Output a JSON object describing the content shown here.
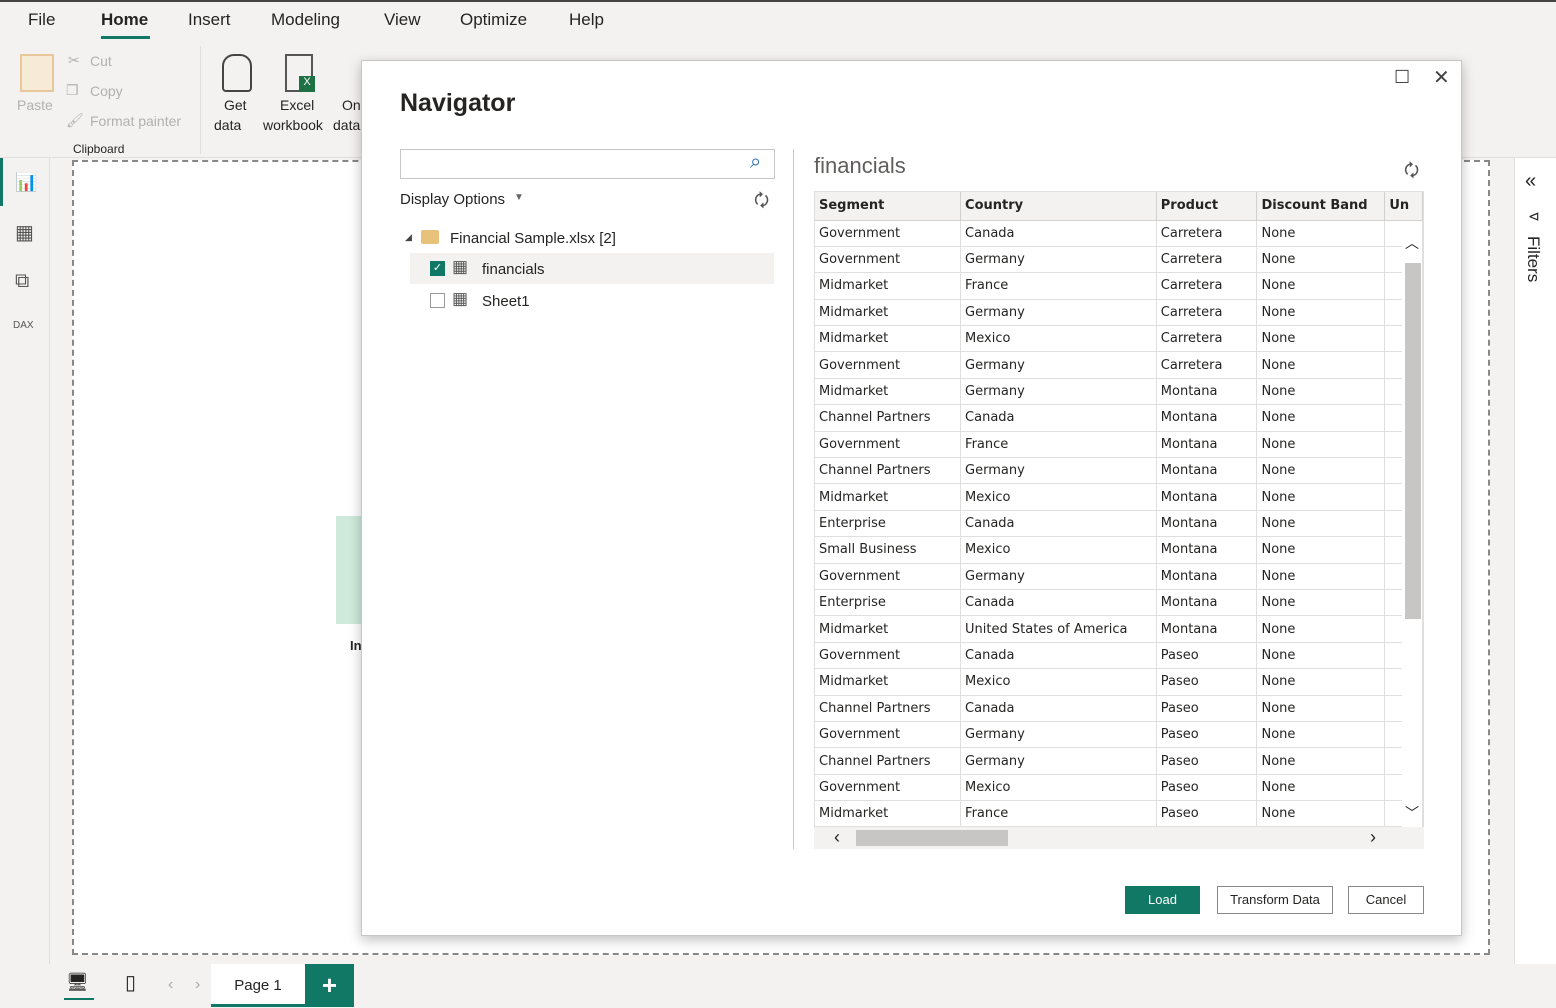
{
  "menu": {
    "items": [
      "File",
      "Home",
      "Insert",
      "Modeling",
      "View",
      "Optimize",
      "Help"
    ],
    "active": "Home"
  },
  "ribbon": {
    "paste": "Paste",
    "cut": "Cut",
    "copy": "Copy",
    "format_painter": "Format painter",
    "clipboard": "Clipboard",
    "get_data_1": "Get",
    "get_data_2": "data",
    "excel_1": "Excel",
    "excel_2": "workbook",
    "on_1": "On",
    "on_2": "data"
  },
  "canvas": {
    "partial_text": "In"
  },
  "filters": {
    "label": "Filters"
  },
  "bottom": {
    "page_tab": "Page 1",
    "add_page": "+"
  },
  "navigator": {
    "title": "Navigator",
    "search_placeholder": "",
    "display_options": "Display Options",
    "tree": {
      "file": "Financial Sample.xlsx [2]",
      "items": [
        {
          "label": "financials",
          "checked": true
        },
        {
          "label": "Sheet1",
          "checked": false
        }
      ]
    },
    "preview_title": "financials",
    "table": {
      "columns": [
        "Segment",
        "Country",
        "Product",
        "Discount Band",
        "Un"
      ],
      "rows": [
        [
          "Government",
          "Canada",
          "Carretera",
          "None"
        ],
        [
          "Government",
          "Germany",
          "Carretera",
          "None"
        ],
        [
          "Midmarket",
          "France",
          "Carretera",
          "None"
        ],
        [
          "Midmarket",
          "Germany",
          "Carretera",
          "None"
        ],
        [
          "Midmarket",
          "Mexico",
          "Carretera",
          "None"
        ],
        [
          "Government",
          "Germany",
          "Carretera",
          "None"
        ],
        [
          "Midmarket",
          "Germany",
          "Montana",
          "None"
        ],
        [
          "Channel Partners",
          "Canada",
          "Montana",
          "None"
        ],
        [
          "Government",
          "France",
          "Montana",
          "None"
        ],
        [
          "Channel Partners",
          "Germany",
          "Montana",
          "None"
        ],
        [
          "Midmarket",
          "Mexico",
          "Montana",
          "None"
        ],
        [
          "Enterprise",
          "Canada",
          "Montana",
          "None"
        ],
        [
          "Small Business",
          "Mexico",
          "Montana",
          "None"
        ],
        [
          "Government",
          "Germany",
          "Montana",
          "None"
        ],
        [
          "Enterprise",
          "Canada",
          "Montana",
          "None"
        ],
        [
          "Midmarket",
          "United States of America",
          "Montana",
          "None"
        ],
        [
          "Government",
          "Canada",
          "Paseo",
          "None"
        ],
        [
          "Midmarket",
          "Mexico",
          "Paseo",
          "None"
        ],
        [
          "Channel Partners",
          "Canada",
          "Paseo",
          "None"
        ],
        [
          "Government",
          "Germany",
          "Paseo",
          "None"
        ],
        [
          "Channel Partners",
          "Germany",
          "Paseo",
          "None"
        ],
        [
          "Government",
          "Mexico",
          "Paseo",
          "None"
        ],
        [
          "Midmarket",
          "France",
          "Paseo",
          "None"
        ]
      ]
    },
    "buttons": {
      "load": "Load",
      "transform": "Transform Data",
      "cancel": "Cancel"
    }
  },
  "colors": {
    "accent": "#117865",
    "load_bg": "#117865"
  }
}
